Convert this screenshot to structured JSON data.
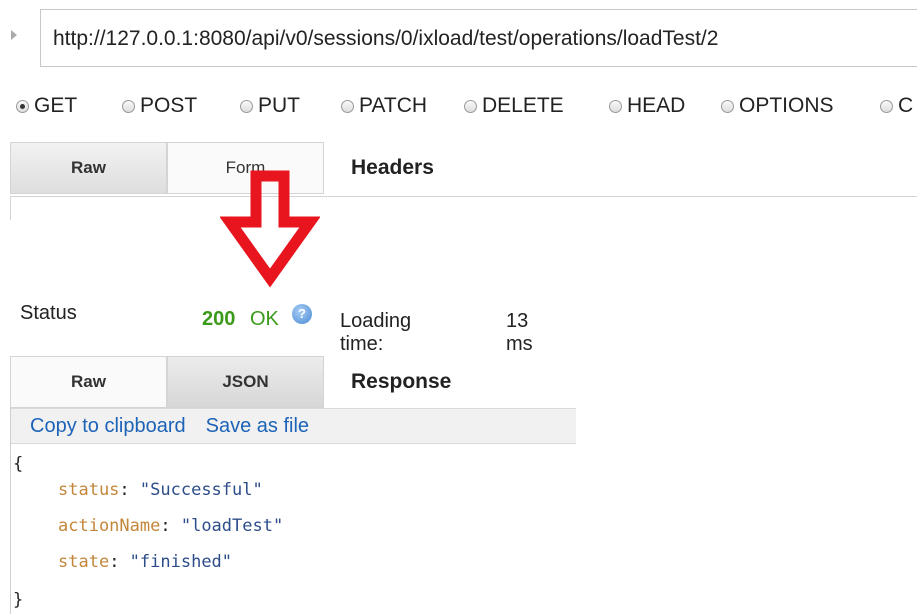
{
  "url": {
    "value": "http://127.0.0.1:8080/api/v0/sessions/0/ixload/test/operations/loadTest/2"
  },
  "methods": [
    {
      "label": "GET",
      "checked": true
    },
    {
      "label": "POST",
      "checked": false
    },
    {
      "label": "PUT",
      "checked": false
    },
    {
      "label": "PATCH",
      "checked": false
    },
    {
      "label": "DELETE",
      "checked": false
    },
    {
      "label": "HEAD",
      "checked": false
    },
    {
      "label": "OPTIONS",
      "checked": false
    },
    {
      "label": "C",
      "checked": false
    }
  ],
  "request_tabs": {
    "raw": "Raw",
    "form": "Form",
    "label": "Headers"
  },
  "status": {
    "label": "Status",
    "code": "200",
    "text": "OK",
    "help_icon": "help-icon",
    "loading_label": "Loading time:",
    "loading_value": "13 ms"
  },
  "response_tabs": {
    "raw": "Raw",
    "json": "JSON",
    "label": "Response"
  },
  "response": {
    "copy_link": "Copy to clipboard",
    "save_link": "Save as file",
    "open_brace": "{",
    "close_brace": "}",
    "fields": [
      {
        "key": "status",
        "value": "\"Successful\""
      },
      {
        "key": "actionName",
        "value": "\"loadTest\""
      },
      {
        "key": "state",
        "value": "\"finished\""
      }
    ]
  },
  "colors": {
    "status_ok": "#3c9a1b",
    "link": "#1c63b8",
    "annotation_arrow": "#e8141e"
  }
}
